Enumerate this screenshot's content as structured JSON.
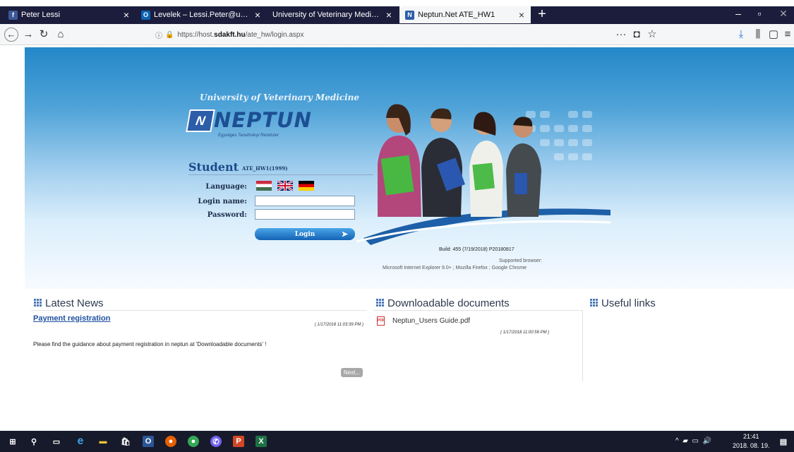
{
  "tabs": [
    {
      "label": "Peter Lessi",
      "icon": "facebook-icon",
      "icon_color": "#3b5998"
    },
    {
      "label": "Levelek – Lessi.Peter@univet.h",
      "icon": "outlook-icon",
      "icon_color": "#0a64b4"
    },
    {
      "label": "University of Veterinary Medicine B",
      "icon": "",
      "icon_color": ""
    },
    {
      "label": "Neptun.Net ATE_HW1",
      "icon": "neptun-icon",
      "icon_color": "#2c5da8"
    }
  ],
  "address": {
    "prefix": "https://host.",
    "domain": "sdakft.hu",
    "path": "/ate_hw/login.aspx"
  },
  "header": {
    "university": "University of Veterinary Medicine",
    "logo_text": "NEPTUN",
    "logo_sub": "Egységes Tanulmányi Rendszer",
    "logo_mark": "N"
  },
  "login": {
    "role": "Student",
    "code": "ATE_HW1(1999)",
    "language_label": "Language:",
    "login_name_label": "Login name:",
    "password_label": "Password:",
    "login_button": "Login",
    "languages": [
      "Hungarian",
      "English",
      "German"
    ]
  },
  "footer_info": {
    "build": "Build: 455 (7/19/2018) P20180817",
    "supported": "Supported browser:",
    "browsers": "Microsoft Internet Explorer 9.0+ ; Mozilla Firefox ; Google Chrome"
  },
  "news": {
    "title": "Latest News",
    "item_title": "Payment registration",
    "item_date": "( 1/17/2018 11:03:39 PM )",
    "item_body": "Please find the guidance about payment registration in neptun at 'Downloadable documents' !",
    "next_button": "Next..."
  },
  "documents": {
    "title": "Downloadable documents",
    "file_name": "Neptun_Users Guide.pdf",
    "file_date": "( 1/17/2018 11:00:56 PM )"
  },
  "links": {
    "title": "Useful links"
  },
  "taskbar": {
    "time": "21:41",
    "date": "2018. 08. 19."
  }
}
